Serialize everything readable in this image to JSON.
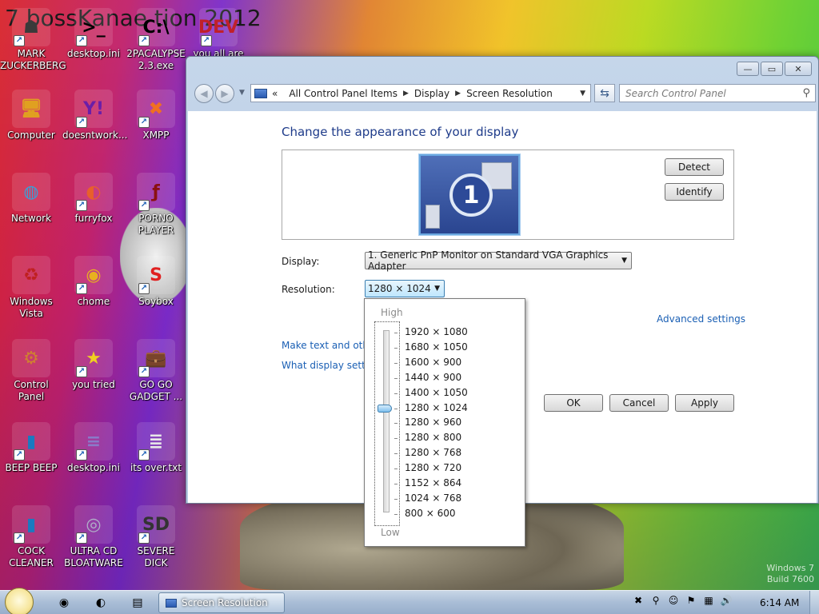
{
  "desktop": {
    "wallpaper_title": "7 bossKanae tion 2012",
    "watermark": [
      "Windows 7",
      "Build 7600"
    ],
    "icons": [
      {
        "label": "MARK ZUCKERBERG",
        "icon": "person-figure-icon",
        "color": "#3a3a3a",
        "glyph": "☗"
      },
      {
        "label": "desktop.ini",
        "icon": "cmd-terminal-icon",
        "color": "#000000",
        "glyph": ">_"
      },
      {
        "label": "2PACALYPSE 2.3.exe",
        "icon": "cmd-terminal-icon",
        "color": "#000000",
        "glyph": "C:\\"
      },
      {
        "label": "you all are",
        "icon": "dev-cpp-icon",
        "color": "#c0202a",
        "glyph": "DEV"
      },
      {
        "label": "Computer",
        "icon": "computer-icon",
        "color": "#e0a020",
        "glyph": "🖥"
      },
      {
        "label": "doesntwork...",
        "icon": "yahoo-messenger-icon",
        "color": "#6a1ea8",
        "glyph": "Y!"
      },
      {
        "label": "XMPP",
        "icon": "xampp-icon",
        "color": "#f07020",
        "glyph": "✖"
      },
      {
        "label": "Network",
        "icon": "network-globe-icon",
        "color": "#3aa0d8",
        "glyph": "◍"
      },
      {
        "label": "furryfox",
        "icon": "firefox-icon",
        "color": "#e8602a",
        "glyph": "◐"
      },
      {
        "label": "PORNO PLAYER",
        "icon": "flash-player-icon",
        "color": "#8a1010",
        "glyph": "ƒ"
      },
      {
        "label": "Windows Vista",
        "icon": "recycle-bin-icon",
        "color": "#c02020",
        "glyph": "♻"
      },
      {
        "label": "chome",
        "icon": "chrome-icon",
        "color": "#e8b020",
        "glyph": "◉"
      },
      {
        "label": "Soybox",
        "icon": "soybox-s-icon",
        "color": "#e02020",
        "glyph": "S"
      },
      {
        "label": "Control Panel",
        "icon": "control-panel-icon",
        "color": "#d08030",
        "glyph": "⚙"
      },
      {
        "label": "you tried",
        "icon": "gold-star-icon",
        "color": "#f0d020",
        "glyph": "★"
      },
      {
        "label": "GO GO GADGET ...",
        "icon": "briefcase-icon",
        "color": "#b06a20",
        "glyph": "💼"
      },
      {
        "label": "BEEP BEEP",
        "icon": "blue-book-icon",
        "color": "#1a7ac0",
        "glyph": "▮"
      },
      {
        "label": "desktop.ini",
        "icon": "settings-file-icon",
        "color": "#8a7ac8",
        "glyph": "≡"
      },
      {
        "label": "its over.txt",
        "icon": "text-file-icon",
        "color": "#e8e8e8",
        "glyph": "≣"
      },
      {
        "label": "COCK CLEANER",
        "icon": "blue-book-icon",
        "color": "#1a7ac0",
        "glyph": "▮"
      },
      {
        "label": "ULTRA CD BLOATWARE",
        "icon": "cd-disc-icon",
        "color": "#b0b0c8",
        "glyph": "◎"
      },
      {
        "label": "SEVERE DICK",
        "icon": "sd-card-gear-icon",
        "color": "#333333",
        "glyph": "SD"
      }
    ]
  },
  "window": {
    "title": "Screen Resolution",
    "controls": {
      "minimize": "—",
      "maximize": "▭",
      "close": "✕"
    },
    "nav": {
      "breadcrumb": [
        "All Control Panel Items",
        "Display",
        "Screen Resolution"
      ],
      "breadcrumb_prefix": "«",
      "search_placeholder": "Search Control Panel"
    },
    "content": {
      "heading": "Change the appearance of your display",
      "monitor_number": "1",
      "detect_label": "Detect",
      "identify_label": "Identify",
      "display_label": "Display:",
      "display_value": "1. Generic PnP Monitor on Standard VGA Graphics Adapter",
      "resolution_label": "Resolution:",
      "resolution_value": "1280 × 1024",
      "advanced_settings": "Advanced settings",
      "link_text_size": "Make text and other",
      "link_display_settings": "What display setting",
      "ok_label": "OK",
      "cancel_label": "Cancel",
      "apply_label": "Apply"
    },
    "resolution_dropdown": {
      "high_label": "High",
      "low_label": "Low",
      "options": [
        "1920 × 1080",
        "1680 × 1050",
        "1600 × 900",
        "1440 × 900",
        "1400 × 1050",
        "1280 × 1024",
        "1280 × 960",
        "1280 × 800",
        "1280 × 768",
        "1280 × 720",
        "1152 × 864",
        "1024 × 768",
        "800 × 600"
      ],
      "selected": "1280 × 1024",
      "selected_index": 5
    }
  },
  "taskbar": {
    "pinned": [
      {
        "icon": "chrome-icon",
        "glyph": "◉"
      },
      {
        "icon": "firefox-icon",
        "glyph": "◐"
      },
      {
        "icon": "file-explorer-icon",
        "glyph": "▤"
      }
    ],
    "task_label": "Screen Resolution",
    "tray": [
      {
        "icon": "xampp-tray-icon",
        "glyph": "✖"
      },
      {
        "icon": "search-tray-icon",
        "glyph": "⚲"
      },
      {
        "icon": "smiley-tray-icon",
        "glyph": "☺"
      },
      {
        "icon": "action-center-flag-icon",
        "glyph": "⚑"
      },
      {
        "icon": "network-tray-icon",
        "glyph": "▦"
      },
      {
        "icon": "volume-icon",
        "glyph": "🔊"
      }
    ],
    "clock": "6:14 AM"
  }
}
